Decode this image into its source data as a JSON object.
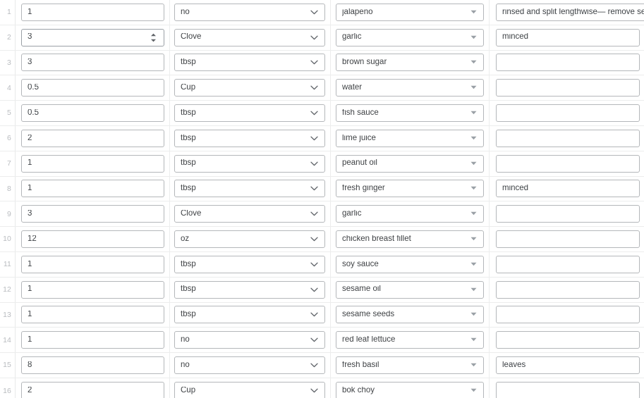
{
  "table": {
    "columns": [
      {
        "key": "quantity",
        "name": "quantity-column"
      },
      {
        "key": "unit",
        "name": "unit-column"
      },
      {
        "key": "ingredient",
        "name": "ingredient-column"
      },
      {
        "key": "preparation",
        "name": "preparation-column"
      }
    ],
    "icons": {
      "unit_dropdown": "chevron-down-icon",
      "ingredient_dropdown": "caret-down-icon",
      "quantity_stepper": "spinner-updown-icon"
    },
    "colors": {
      "field_border": "#b4b7ba",
      "row_divider": "#eceded",
      "row_number": "#b9bcc0",
      "text": "#3f4245",
      "background": "#ffffff"
    },
    "rows": [
      {
        "num": "1",
        "quantity": "1",
        "unit": "no",
        "ingredient": "jalapeno",
        "preparation": "rinsed and split lengthwise— remove seed",
        "active": false
      },
      {
        "num": "2",
        "quantity": "3",
        "unit": "Clove",
        "ingredient": "garlic",
        "preparation": "minced",
        "active": true
      },
      {
        "num": "3",
        "quantity": "3",
        "unit": "tbsp",
        "ingredient": "brown sugar",
        "preparation": "",
        "active": false
      },
      {
        "num": "4",
        "quantity": "0.5",
        "unit": "Cup",
        "ingredient": "water",
        "preparation": "",
        "active": false
      },
      {
        "num": "5",
        "quantity": "0.5",
        "unit": "tbsp",
        "ingredient": "fish sauce",
        "preparation": "",
        "active": false
      },
      {
        "num": "6",
        "quantity": "2",
        "unit": "tbsp",
        "ingredient": "lime juice",
        "preparation": "",
        "active": false
      },
      {
        "num": "7",
        "quantity": "1",
        "unit": "tbsp",
        "ingredient": "peanut oil",
        "preparation": "",
        "active": false
      },
      {
        "num": "8",
        "quantity": "1",
        "unit": "tbsp",
        "ingredient": "fresh ginger",
        "preparation": "minced",
        "active": false
      },
      {
        "num": "9",
        "quantity": "3",
        "unit": "Clove",
        "ingredient": "garlic",
        "preparation": "",
        "active": false
      },
      {
        "num": "10",
        "quantity": "12",
        "unit": "oz",
        "ingredient": "chicken breast fillet",
        "preparation": "",
        "active": false
      },
      {
        "num": "11",
        "quantity": "1",
        "unit": "tbsp",
        "ingredient": "soy sauce",
        "preparation": "",
        "active": false
      },
      {
        "num": "12",
        "quantity": "1",
        "unit": "tbsp",
        "ingredient": "sesame oil",
        "preparation": "",
        "active": false
      },
      {
        "num": "13",
        "quantity": "1",
        "unit": "tbsp",
        "ingredient": "sesame seeds",
        "preparation": "",
        "active": false
      },
      {
        "num": "14",
        "quantity": "1",
        "unit": "no",
        "ingredient": "red leaf lettuce",
        "preparation": "",
        "active": false
      },
      {
        "num": "15",
        "quantity": "8",
        "unit": "no",
        "ingredient": "fresh basil",
        "preparation": "leaves",
        "active": false
      },
      {
        "num": "16",
        "quantity": "2",
        "unit": "Cup",
        "ingredient": "bok choy",
        "preparation": "",
        "active": false
      }
    ]
  }
}
